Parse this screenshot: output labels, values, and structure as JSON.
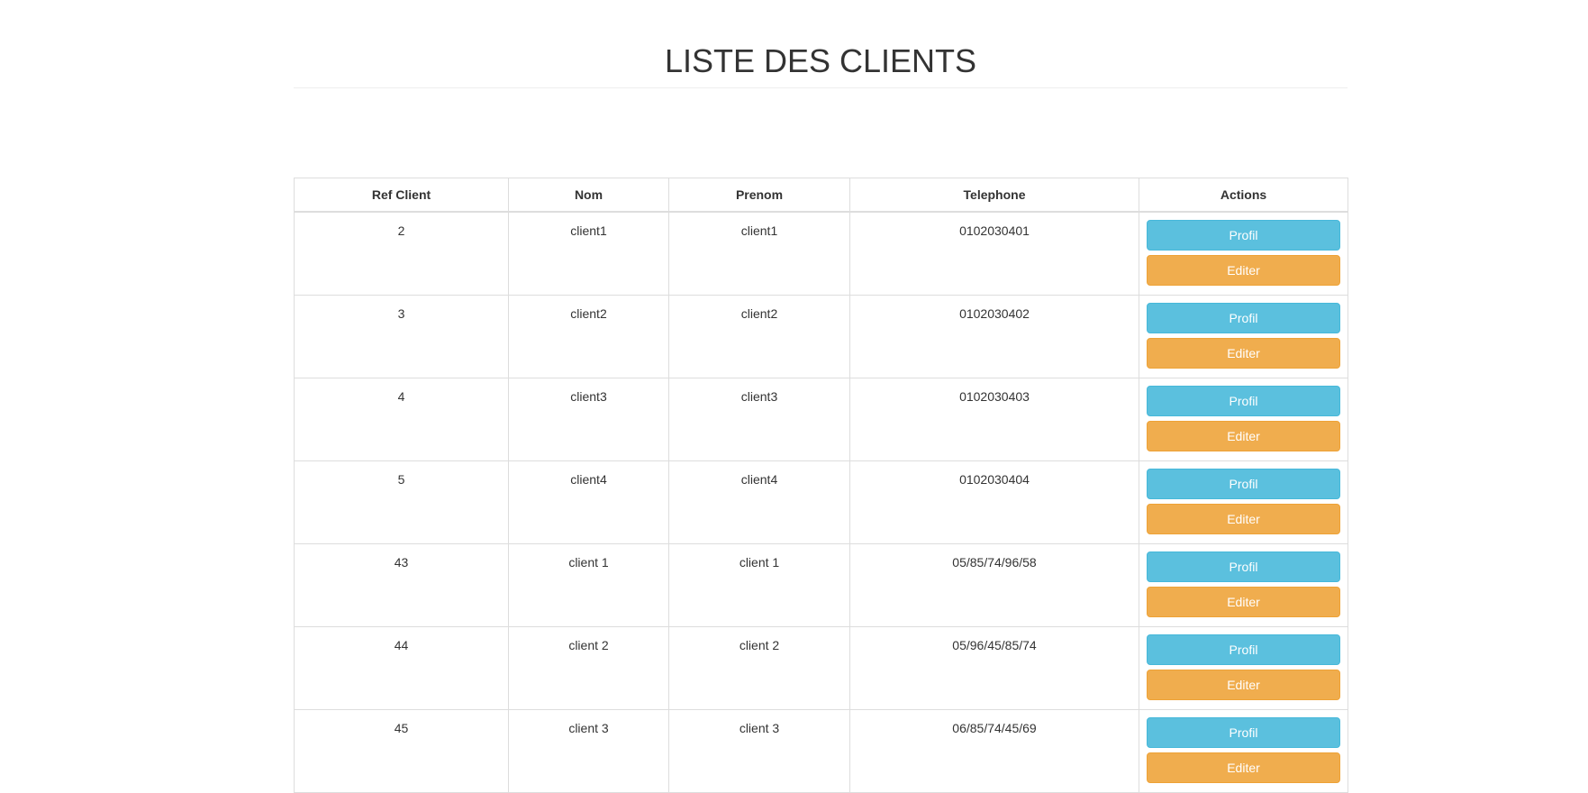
{
  "page": {
    "title": "LISTE DES CLIENTS"
  },
  "table": {
    "headers": [
      "Ref Client",
      "Nom",
      "Prenom",
      "Telephone",
      "Actions"
    ],
    "rows": [
      {
        "ref": "2",
        "nom": "client1",
        "prenom": "client1",
        "telephone": "0102030401"
      },
      {
        "ref": "3",
        "nom": "client2",
        "prenom": "client2",
        "telephone": "0102030402"
      },
      {
        "ref": "4",
        "nom": "client3",
        "prenom": "client3",
        "telephone": "0102030403"
      },
      {
        "ref": "5",
        "nom": "client4",
        "prenom": "client4",
        "telephone": "0102030404"
      },
      {
        "ref": "43",
        "nom": "client 1",
        "prenom": "client 1",
        "telephone": "05/85/74/96/58"
      },
      {
        "ref": "44",
        "nom": "client 2",
        "prenom": "client 2",
        "telephone": "05/96/45/85/74"
      },
      {
        "ref": "45",
        "nom": "client 3",
        "prenom": "client 3",
        "telephone": "06/85/74/45/69"
      }
    ],
    "actions": {
      "profil_label": "Profil",
      "editer_label": "Editer"
    }
  },
  "colors": {
    "profil_button": "#5bc0de",
    "editer_button": "#f0ad4e",
    "border": "#dddddd",
    "text": "#333333"
  }
}
